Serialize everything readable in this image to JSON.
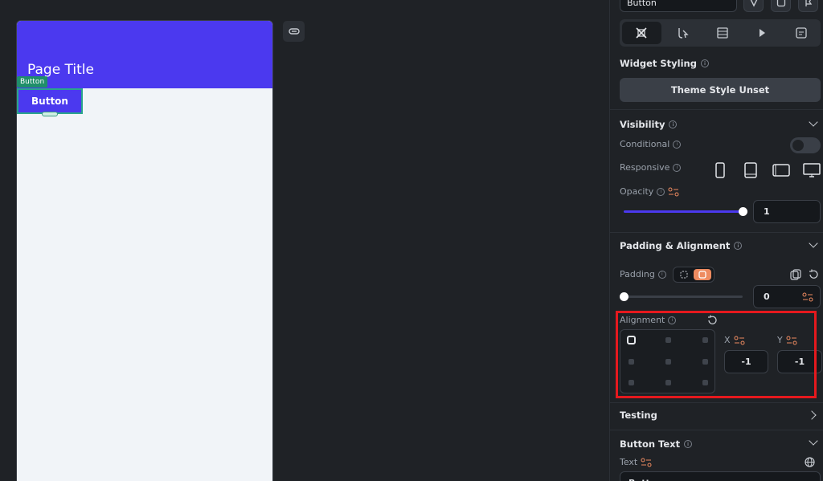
{
  "canvas": {
    "page_title": "Page Title",
    "selected_tag": "Button",
    "button_label": "Button"
  },
  "panel": {
    "widget_name": "Button",
    "tabs": [
      {
        "icon": "paint-tools-icon",
        "active": true
      },
      {
        "icon": "actions-icon",
        "active": false
      },
      {
        "icon": "backend-query-icon",
        "active": false
      },
      {
        "icon": "play-icon",
        "active": false
      },
      {
        "icon": "notes-icon",
        "active": false
      }
    ],
    "widget_styling": {
      "title": "Widget Styling",
      "theme_button": "Theme Style Unset"
    },
    "visibility": {
      "title": "Visibility",
      "conditional_label": "Conditional",
      "responsive_label": "Responsive",
      "opacity_label": "Opacity",
      "opacity_value": "1",
      "opacity_fraction": 1.0
    },
    "padding_alignment": {
      "title": "Padding & Alignment",
      "padding_label": "Padding",
      "padding_value": "0",
      "alignment_label": "Alignment",
      "x_label": "X",
      "y_label": "Y",
      "x_value": "-1",
      "y_value": "-1"
    },
    "testing": {
      "title": "Testing"
    },
    "button_text": {
      "title": "Button Text",
      "text_label": "Text",
      "text_value": "Button"
    }
  },
  "colors": {
    "primary": "#4b39ef",
    "accent_orange": "#ee8b60",
    "highlight_red": "#e5191e",
    "selection_green": "#1f8f6a"
  }
}
